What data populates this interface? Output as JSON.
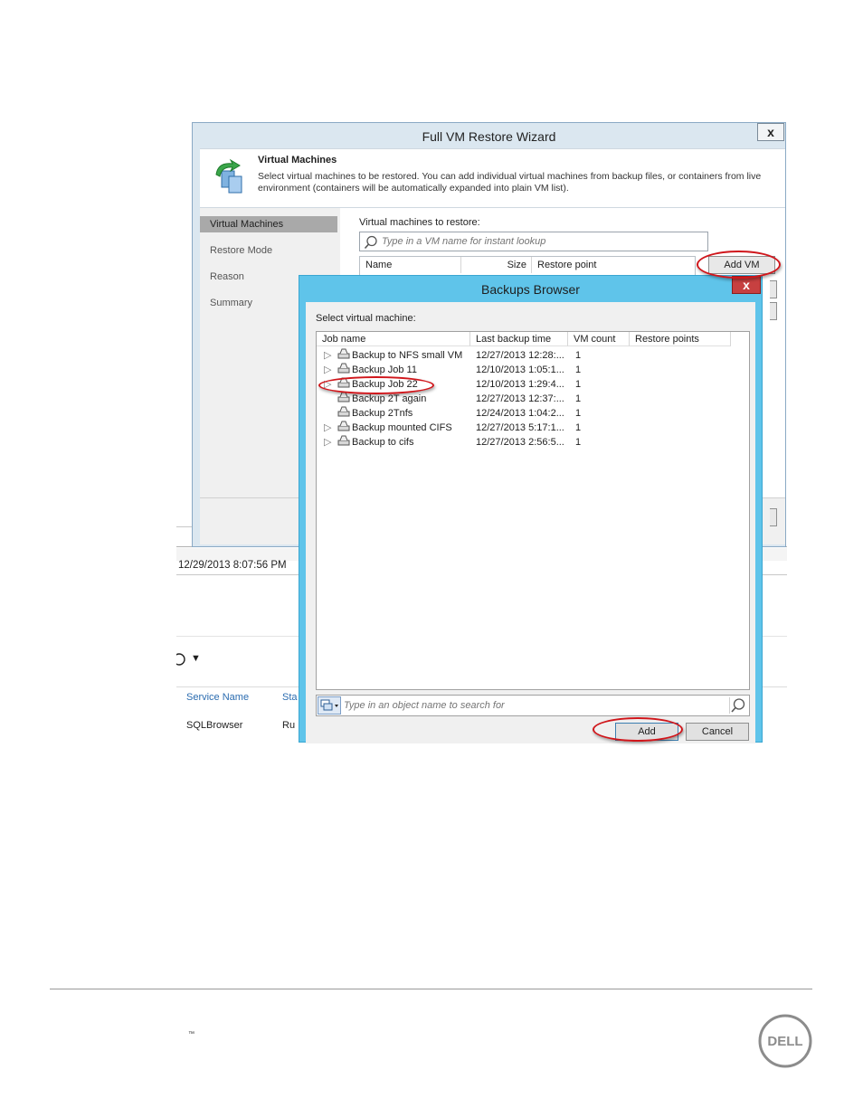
{
  "background_app": {
    "timestamp": "12/29/2013 8:07:56 PM",
    "services": {
      "column_service_name": "Service Name",
      "column_status_partial": "Sta",
      "row_service": "SQLBrowser",
      "row_status_partial": "Ru"
    }
  },
  "wizard": {
    "title": "Full VM Restore Wizard",
    "close_label": "x",
    "step_title": "Virtual Machines",
    "step_description": "Select virtual machines to be restored. You can add individual virtual machines from backup files, or containers from live environment (containers will be automatically expanded into plain VM list).",
    "nav": [
      "Virtual Machines",
      "Restore Mode",
      "Reason",
      "Summary"
    ],
    "vm_list_label": "Virtual machines to restore:",
    "vm_search_placeholder": "Type in a VM name for instant lookup",
    "vm_table_headers": [
      "Name",
      "Size",
      "Restore point"
    ],
    "add_vm_label": "Add VM"
  },
  "backups_browser": {
    "title": "Backups Browser",
    "close_label": "x",
    "prompt": "Select virtual machine:",
    "headers": [
      "Job name",
      "Last backup time",
      "VM count",
      "Restore points"
    ],
    "jobs": [
      {
        "name": "Backup to NFS small VM",
        "time": "12/27/2013 12:28:...",
        "count": "1",
        "expandable": true
      },
      {
        "name": "Backup Job 11",
        "time": "12/10/2013 1:05:1...",
        "count": "1",
        "expandable": true
      },
      {
        "name": "Backup Job 22",
        "time": "12/10/2013 1:29:4...",
        "count": "1",
        "expandable": true
      },
      {
        "name": "Backup 2T again",
        "time": "12/27/2013 12:37:...",
        "count": "1",
        "expandable": false
      },
      {
        "name": "Backup 2Tnfs",
        "time": "12/24/2013 1:04:2...",
        "count": "1",
        "expandable": false
      },
      {
        "name": "Backup mounted CIFS",
        "time": "12/27/2013 5:17:1...",
        "count": "1",
        "expandable": true
      },
      {
        "name": "Backup to cifs",
        "time": "12/27/2013 2:56:5...",
        "count": "1",
        "expandable": true
      }
    ],
    "object_search_placeholder": "Type in an object name to search for",
    "add_label": "Add",
    "cancel_label": "Cancel"
  },
  "footer": {
    "trademark": "™",
    "logo_text": "DELL"
  },
  "colors": {
    "annotation_red": "#d0161b",
    "browser_frame": "#5fc4ea",
    "nav_active": "#a9a9a9",
    "link_blue": "#2b6cb0"
  }
}
